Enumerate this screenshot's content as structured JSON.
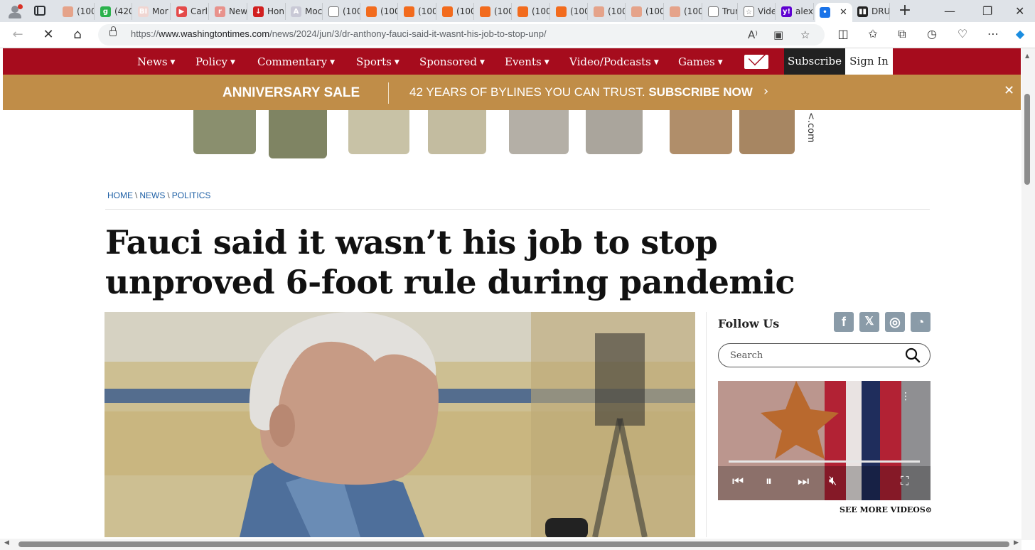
{
  "browser": {
    "tabs": [
      {
        "label": "(100",
        "fav_color": "#e5a38a",
        "fav_glyph": ""
      },
      {
        "label": "(420",
        "fav_color": "#2bb24c",
        "fav_glyph": "g"
      },
      {
        "label": "Mor",
        "fav_color": "#f0d6d2",
        "fav_glyph": "BI"
      },
      {
        "label": "Carl",
        "fav_color": "#e44a4a",
        "fav_glyph": "▶"
      },
      {
        "label": "New",
        "fav_color": "#e8928c",
        "fav_glyph": "r"
      },
      {
        "label": "Hon",
        "fav_color": "#d11f1f",
        "fav_glyph": "↓"
      },
      {
        "label": "Moc",
        "fav_color": "#c9c9d6",
        "fav_glyph": "A"
      },
      {
        "label": "(100",
        "fav_color": "#ffffff",
        "fav_glyph": ""
      },
      {
        "label": "(100",
        "fav_color": "#f26b1d",
        "fav_glyph": ""
      },
      {
        "label": "(100",
        "fav_color": "#f26b1d",
        "fav_glyph": ""
      },
      {
        "label": "(100",
        "fav_color": "#f26b1d",
        "fav_glyph": ""
      },
      {
        "label": "(100",
        "fav_color": "#f26b1d",
        "fav_glyph": ""
      },
      {
        "label": "(100",
        "fav_color": "#f26b1d",
        "fav_glyph": ""
      },
      {
        "label": "(100",
        "fav_color": "#f26b1d",
        "fav_glyph": ""
      },
      {
        "label": "(100",
        "fav_color": "#e5a38a",
        "fav_glyph": ""
      },
      {
        "label": "(100",
        "fav_color": "#e5a38a",
        "fav_glyph": ""
      },
      {
        "label": "(100",
        "fav_color": "#e5a38a",
        "fav_glyph": ""
      },
      {
        "label": "Trun",
        "fav_color": "#ffffff",
        "fav_glyph": ""
      },
      {
        "label": "Vide",
        "fav_color": "#ffffff",
        "fav_glyph": "☆"
      },
      {
        "label": "alex",
        "fav_color": "#5f01d1",
        "fav_glyph": "y!"
      },
      {
        "label": "",
        "fav_color": "#1a73e8",
        "fav_glyph": "•"
      },
      {
        "label": "DRU",
        "fav_color": "#222222",
        "fav_glyph": "▮▮"
      }
    ],
    "url_prefix": "https://",
    "url_domain": "www.washingtontimes.com",
    "url_path": "/news/2024/jun/3/dr-anthony-fauci-said-it-wasnt-his-job-to-stop-unp/"
  },
  "site": {
    "nav": {
      "items": [
        "News",
        "Policy",
        "Commentary",
        "Sports",
        "Sponsored",
        "Events",
        "Video/Podcasts",
        "Games"
      ],
      "subscribe": "Subscribe",
      "sign_in": "Sign In"
    },
    "promo": {
      "left": "ANNIVERSARY SALE",
      "text": "42 YEARS OF BYLINES YOU CAN TRUST.",
      "cta": "SUBSCRIBE NOW"
    },
    "ad": {
      "domain_fragment": "<.com"
    }
  },
  "article": {
    "breadcrumb": [
      "HOME",
      "NEWS",
      "POLITICS"
    ],
    "headline": "Fauci said it wasn’t his job to stop unproved 6-foot rule during pandemic"
  },
  "sidebar": {
    "follow_label": "Follow Us",
    "social": [
      {
        "name": "facebook-icon",
        "glyph": "f"
      },
      {
        "name": "x-twitter-icon",
        "glyph": "𝕏"
      },
      {
        "name": "instagram-icon",
        "glyph": "◎"
      },
      {
        "name": "rss-icon",
        "glyph": "◔"
      }
    ],
    "search_placeholder": "Search",
    "see_more": "SEE MORE VIDEOS⊙"
  },
  "colors": {
    "nav_red": "#a60c1d",
    "promo_gold": "#c08d48",
    "link_blue": "#1d5fa5",
    "social_gray": "#8a9ba8"
  }
}
